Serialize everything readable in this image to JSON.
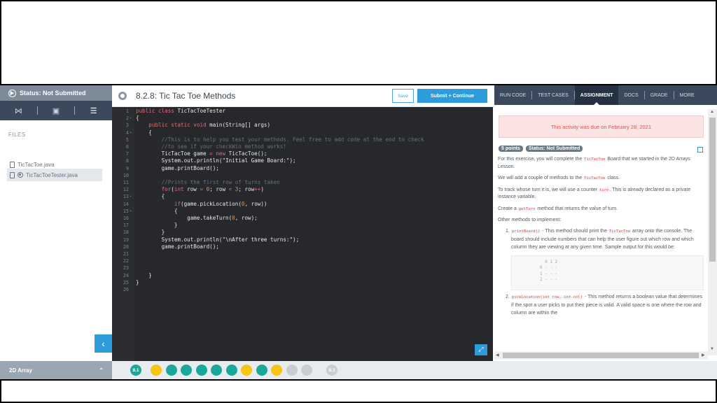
{
  "sidebar": {
    "status": "Status: Not Submitted",
    "files_label": "FILES",
    "files": [
      "TicTacToe.java",
      "TicTacToeTester.java"
    ],
    "section": "2D Array"
  },
  "editor": {
    "title": "8.2.8: Tic Tac Toe Methods",
    "save_label": "Save",
    "submit_label": "Submit + Continue",
    "line_numbers": [
      "1",
      "2",
      "3",
      "4",
      "5",
      "6",
      "7",
      "8",
      "9",
      "10",
      "11",
      "12",
      "13",
      "14",
      "15",
      "16",
      "17",
      "18",
      "19",
      "20",
      "21",
      "22",
      "23",
      "24",
      "25",
      "26"
    ]
  },
  "right_panel": {
    "tabs": [
      "RUN CODE",
      "TEST CASES",
      "ASSIGNMENT",
      "DOCS",
      "GRADE",
      "MORE"
    ],
    "active_tab": "ASSIGNMENT",
    "due_banner": "This activity was due on February 28, 2021",
    "points_badge": "5 points",
    "status_badge": "Status: Not Submitted",
    "p1_a": "For this exercise, you will complete the ",
    "p1_code": "TicTacToe",
    "p1_b": " Board that we started in the 2D Arrays Lesson.",
    "p2_a": "We will add a couple of methods to the ",
    "p2_code": "TicTacToe",
    "p2_b": " class.",
    "p3_a": "To track whose turn it is, we will use a counter ",
    "p3_code": "turn",
    "p3_b": ". This is already declared as a private instance variable.",
    "p4_a": "Create a ",
    "p4_code": "getTurn",
    "p4_b": " method that returns the value of turn.",
    "p5": "Other methods to implement:",
    "li1_num": "1.",
    "li1_code": "printBoard()",
    "li1_a": " - This method should print the ",
    "li1_code2": "TicTacToe",
    "li1_b": " array onto the console. The board should include numbers that can help the user figure out which row and which column they are viewing at any given time. Sample output for this would be:",
    "sample_lines": [
      "  0 1 2",
      "0 - - -",
      "1 - - -",
      "2 - - -"
    ],
    "li2_num": "2.",
    "li2_code": "pickLocation(int row, int col)",
    "li2_a": " - This method returns a boolean value that determines if the spot a user picks to put their piece is valid. A valid space is one where the row and column are within the"
  },
  "bottom_nav": {
    "prev": "8.1",
    "next": "8.3",
    "colors": [
      "#f5c518",
      "#1aa89b",
      "#1aa89b",
      "#1aa89b",
      "#1aa89b",
      "#1aa89b",
      "#f5c518",
      "#1aa89b",
      "#f5c518",
      "#c9ced3",
      "#c9ced3"
    ]
  }
}
